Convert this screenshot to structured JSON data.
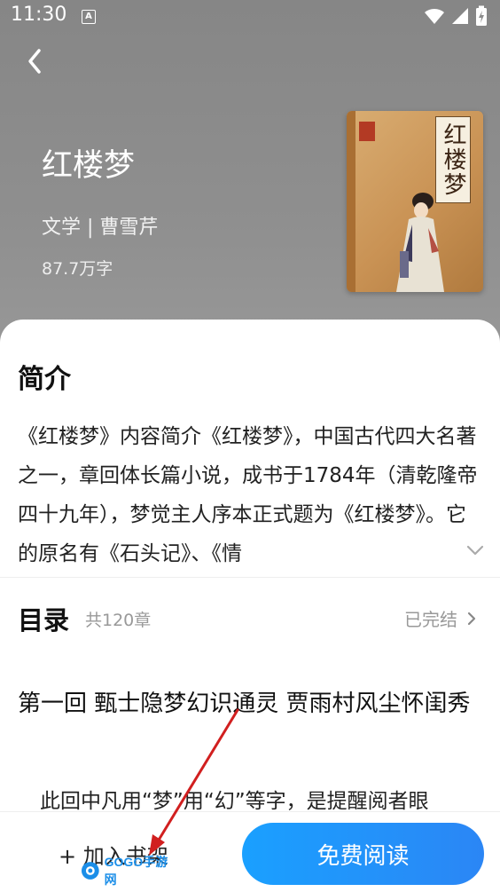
{
  "status_bar": {
    "time": "11:30",
    "notification_badge": "A",
    "icons": [
      "wifi-icon",
      "signal-icon",
      "battery-charging-icon"
    ]
  },
  "header": {
    "back_icon": "chevron-left-icon"
  },
  "book": {
    "title": "红楼梦",
    "meta": "文学 | 曹雪芹",
    "word_count": "87.7万字",
    "cover_title": "红楼梦"
  },
  "intro": {
    "heading": "简介",
    "text": "《红楼梦》内容简介《红楼梦》，中国古代四大名著之一，章回体长篇小说，成书于1784年（清乾隆帝四十九年），梦觉主人序本正式题为《红楼梦》。它的原名有《石头记》、《情",
    "expand_icon": "chevron-down-icon"
  },
  "toc": {
    "heading": "目录",
    "count": "共120章",
    "status": "已完结",
    "status_icon": "chevron-right-icon"
  },
  "chapter": {
    "title": "第一回 甄士隐梦幻识通灵 贾雨村风尘怀闺秀",
    "excerpt": "此回中凡用“梦”用“幻”等字，是提醒阅者眼"
  },
  "bottom_bar": {
    "add_to_shelf": "+ 加入书架",
    "read_free": "免费阅读"
  },
  "colors": {
    "accent": "#1aa0ff",
    "header_gray": "#8c8c8c",
    "annotation_arrow": "#d11f1f"
  },
  "watermark": {
    "text": "GOGO手游网"
  }
}
